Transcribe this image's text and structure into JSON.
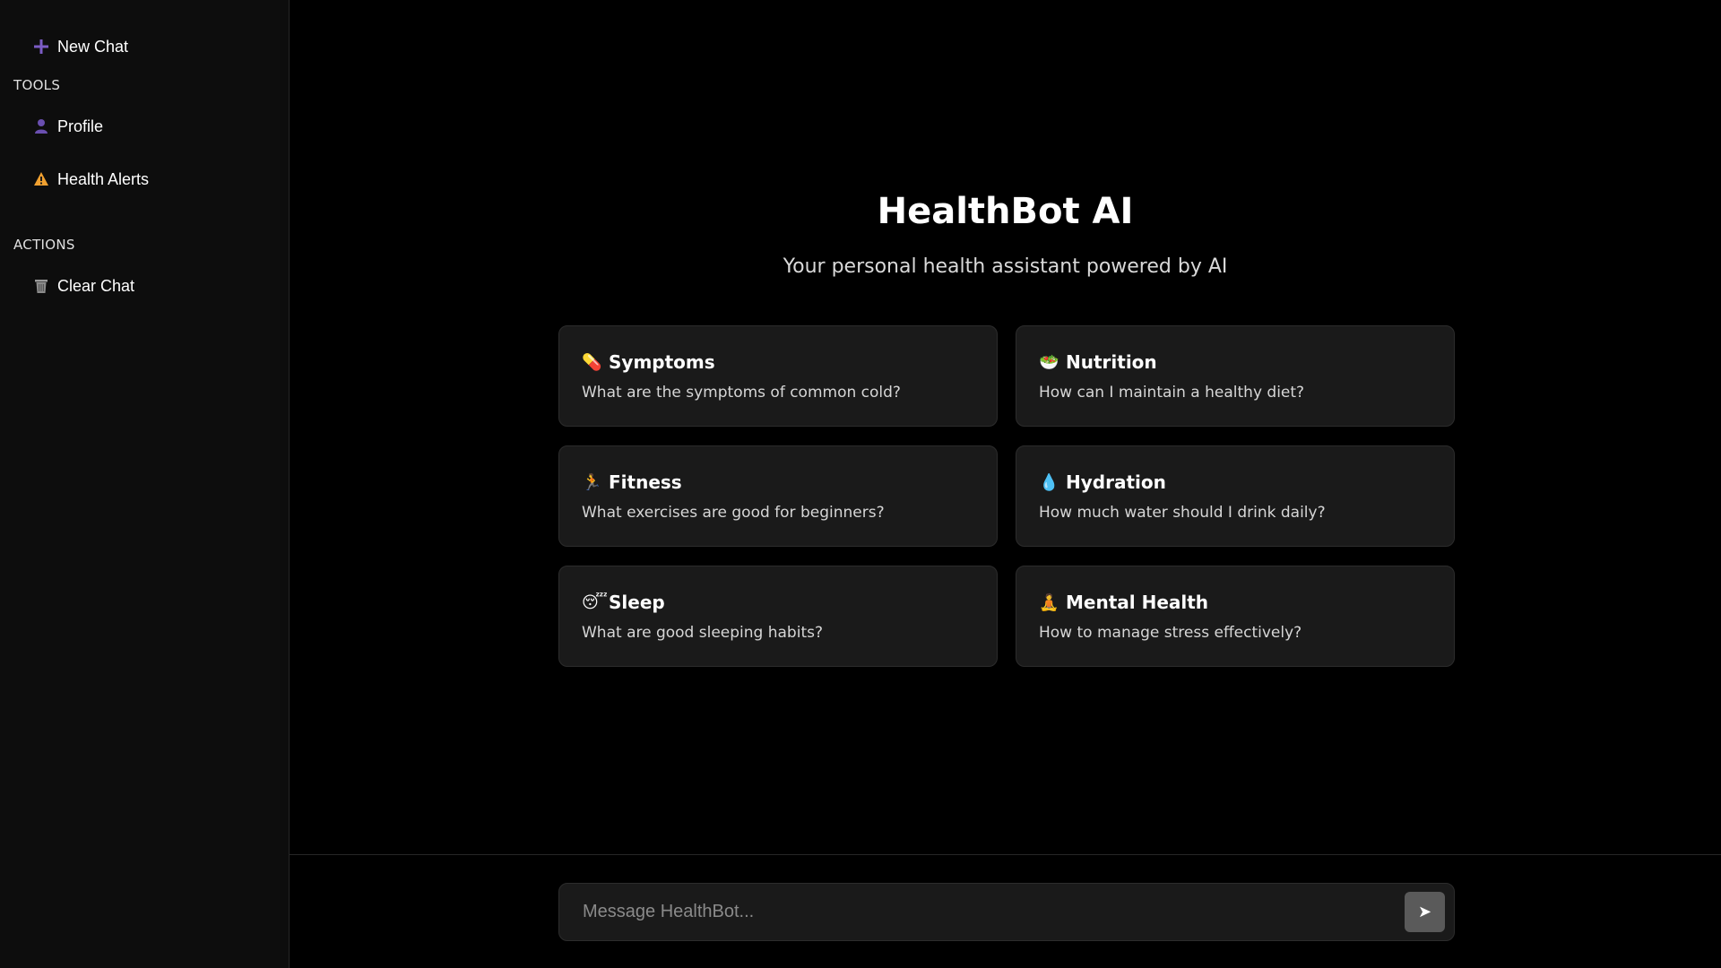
{
  "sidebar": {
    "new_chat": {
      "icon": "plus-icon",
      "label": "New Chat"
    },
    "sections": {
      "tools": "TOOLS",
      "actions": "ACTIONS"
    },
    "tools": [
      {
        "icon": "user-icon",
        "label": "Profile"
      },
      {
        "icon": "warning-icon",
        "label": "Health Alerts"
      }
    ],
    "actions": [
      {
        "icon": "trash-icon",
        "label": "Clear Chat"
      }
    ]
  },
  "hero": {
    "title": "HealthBot AI",
    "subtitle": "Your personal health assistant powered by AI"
  },
  "cards": [
    {
      "emoji": "💊",
      "icon": "pill-icon",
      "title": "Symptoms",
      "text": "What are the symptoms of common cold?"
    },
    {
      "emoji": "🥗",
      "icon": "salad-icon",
      "title": "Nutrition",
      "text": "How can I maintain a healthy diet?"
    },
    {
      "emoji": "🏃",
      "icon": "runner-icon",
      "title": "Fitness",
      "text": "What exercises are good for beginners?"
    },
    {
      "emoji": "💧",
      "icon": "droplet-icon",
      "title": "Hydration",
      "text": "How much water should I drink daily?"
    },
    {
      "emoji": "😴",
      "icon": "sleeping-face-icon",
      "title": "Sleep",
      "text": "What are good sleeping habits?"
    },
    {
      "emoji": "🧘",
      "icon": "meditation-icon",
      "title": "Mental Health",
      "text": "How to manage stress effectively?"
    }
  ],
  "composer": {
    "placeholder": "Message HealthBot...",
    "value": "",
    "send_icon": "send-icon",
    "send_glyph": "➤"
  },
  "colors": {
    "background": "#000000",
    "sidebar_bg": "#0d0d0d",
    "card_bg": "#1a1a1a",
    "accent_purple": "#7b5cc4",
    "warning_orange": "#f0a030",
    "send_button": "#5a5a5a"
  }
}
